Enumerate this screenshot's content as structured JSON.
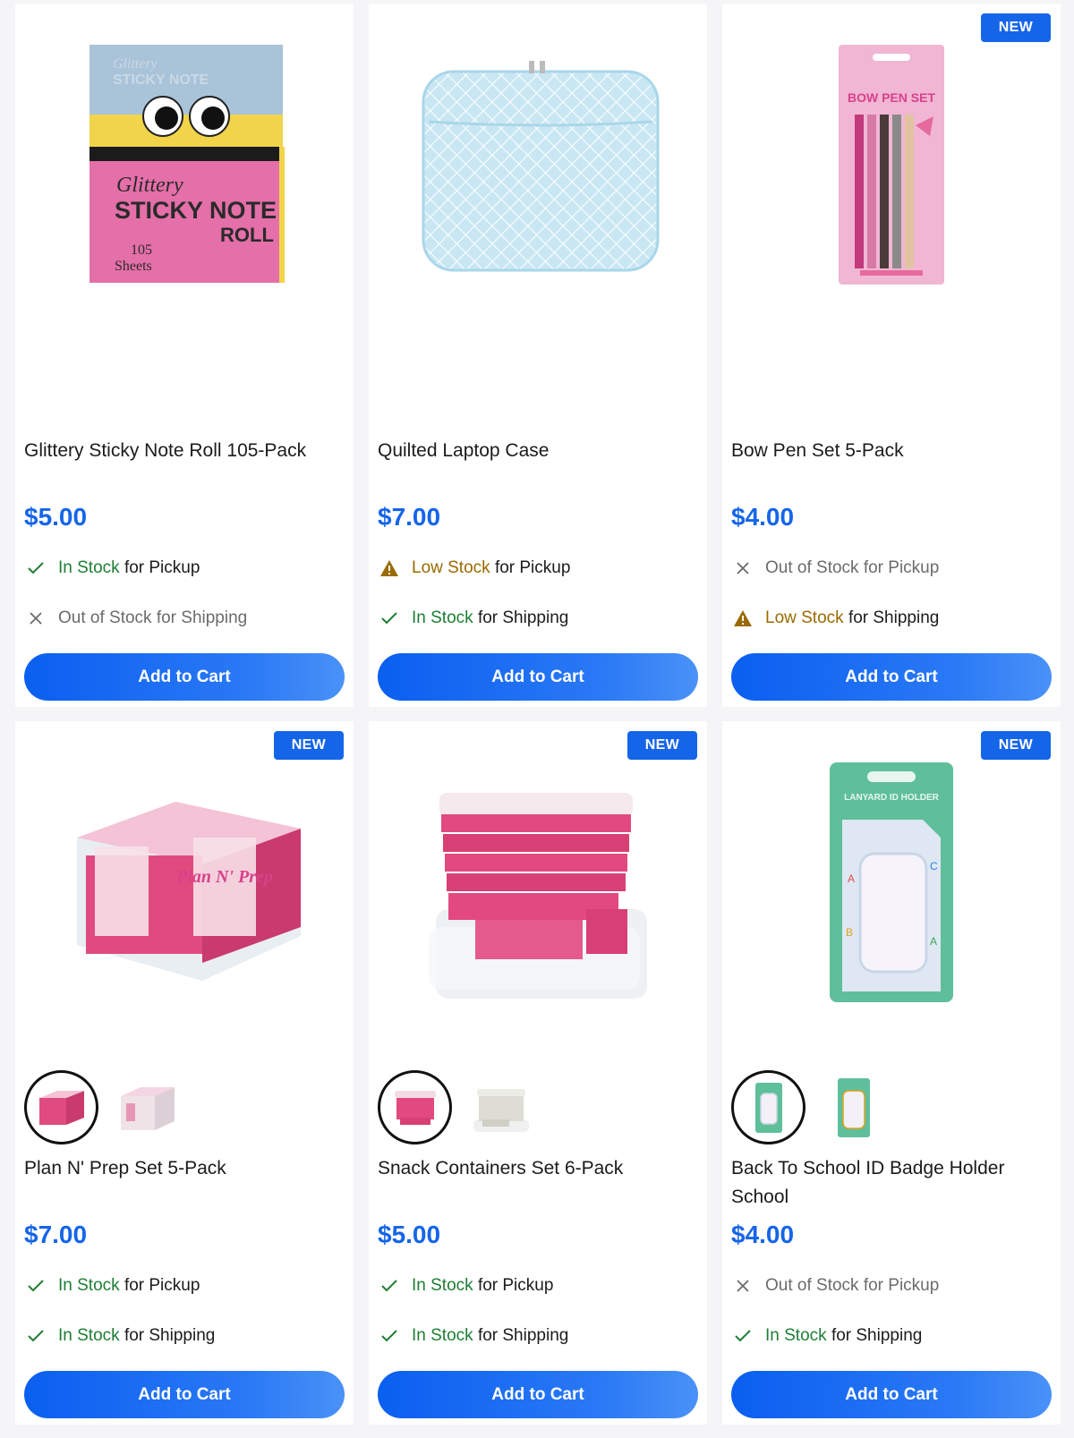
{
  "colors": {
    "accent": "#1565e8",
    "in_stock": "#1e7e34",
    "low_stock": "#9a6a00",
    "out_stock": "#6b6b6b"
  },
  "products": [
    {
      "name": "Glittery Sticky Note Roll 105-Pack",
      "price": "$5.00",
      "badge": "",
      "pickup": {
        "status": "In Stock",
        "suffix": "for Pickup",
        "state": "in"
      },
      "shipping": {
        "status": "Out of Stock for Shipping",
        "suffix": "",
        "state": "out"
      },
      "button": "Add to Cart",
      "image_text": {
        "line1": "Glittery",
        "line2": "STICKY NOTE",
        "line3": "ROLL",
        "line4": "105",
        "line5": "Sheets"
      }
    },
    {
      "name": "Quilted Laptop Case",
      "price": "$7.00",
      "badge": "",
      "pickup": {
        "status": "Low Stock",
        "suffix": "for Pickup",
        "state": "low"
      },
      "shipping": {
        "status": "In Stock",
        "suffix": "for Shipping",
        "state": "in"
      },
      "button": "Add to Cart"
    },
    {
      "name": "Bow Pen Set 5-Pack",
      "price": "$4.00",
      "badge": "NEW",
      "pickup": {
        "status": "Out of Stock for Pickup",
        "suffix": "",
        "state": "out"
      },
      "shipping": {
        "status": "Low Stock",
        "suffix": "for Shipping",
        "state": "low"
      },
      "button": "Add to Cart",
      "image_text": {
        "title": "BOW PEN SET"
      }
    },
    {
      "name": "Plan N' Prep Set 5-Pack",
      "price": "$7.00",
      "badge": "NEW",
      "pickup": {
        "status": "In Stock",
        "suffix": "for Pickup",
        "state": "in"
      },
      "shipping": {
        "status": "In Stock",
        "suffix": "for Shipping",
        "state": "in"
      },
      "button": "Add to Cart",
      "image_text": {
        "title": "Plan N' Prep"
      }
    },
    {
      "name": "Snack Containers Set 6-Pack",
      "price": "$5.00",
      "badge": "NEW",
      "pickup": {
        "status": "In Stock",
        "suffix": "for Pickup",
        "state": "in"
      },
      "shipping": {
        "status": "In Stock",
        "suffix": "for Shipping",
        "state": "in"
      },
      "button": "Add to Cart"
    },
    {
      "name": "Back To School ID Badge Holder School",
      "price": "$4.00",
      "badge": "NEW",
      "pickup": {
        "status": "Out of Stock for Pickup",
        "suffix": "",
        "state": "out"
      },
      "shipping": {
        "status": "In Stock",
        "suffix": "for Shipping",
        "state": "in"
      },
      "button": "Add to Cart",
      "image_text": {
        "title": "LANYARD ID HOLDER"
      }
    }
  ]
}
